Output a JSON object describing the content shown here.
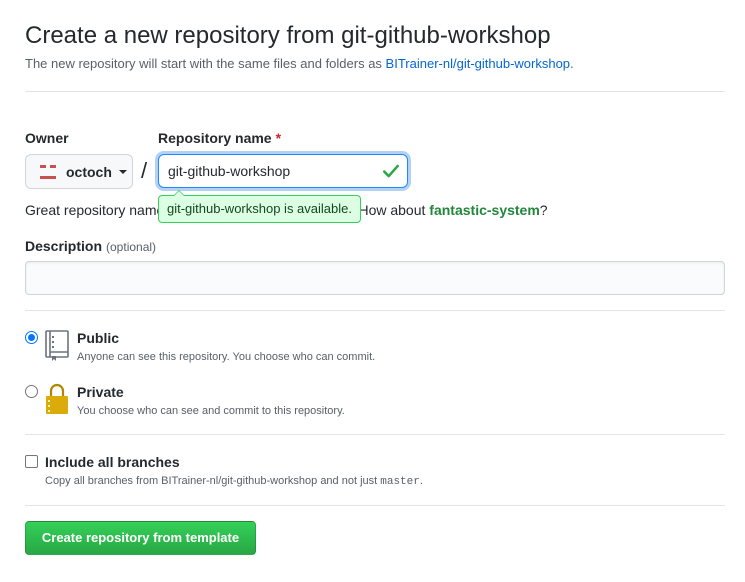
{
  "header": {
    "title": "Create a new repository from git-github-workshop",
    "subtitle_prefix": "The new repository will start with the same files and folders as ",
    "template_link": "BITrainer-nl/git-github-workshop",
    "subtitle_suffix": "."
  },
  "owner": {
    "label": "Owner",
    "value": "octoch",
    "icon": "octoch-avatar"
  },
  "separator": "/",
  "repo_name": {
    "label": "Repository name",
    "required_mark": "*",
    "value": "git-github-workshop",
    "status_icon": "check-icon",
    "availability": "git-github-workshop is available."
  },
  "hint": {
    "prefix": "Great repository name",
    "middle": "d inspiration? How about ",
    "suggestion": "fantastic-system",
    "suffix": "?"
  },
  "description": {
    "label": "Description",
    "optional": "(optional)",
    "value": ""
  },
  "visibility": {
    "public": {
      "title": "Public",
      "note": "Anyone can see this repository. You choose who can commit.",
      "icon": "repo-book-icon",
      "checked": true
    },
    "private": {
      "title": "Private",
      "note": "You choose who can see and commit to this repository.",
      "icon": "lock-icon",
      "checked": false
    }
  },
  "branches": {
    "label": "Include all branches",
    "note_prefix": "Copy all branches from BITrainer-nl/git-github-workshop and not just ",
    "note_code": "master",
    "note_suffix": ".",
    "checked": false
  },
  "submit": {
    "label": "Create repository from template"
  },
  "colors": {
    "link": "#0366d6",
    "success": "#28a745",
    "focus": "#2188ff",
    "suggestion": "#22863a"
  }
}
